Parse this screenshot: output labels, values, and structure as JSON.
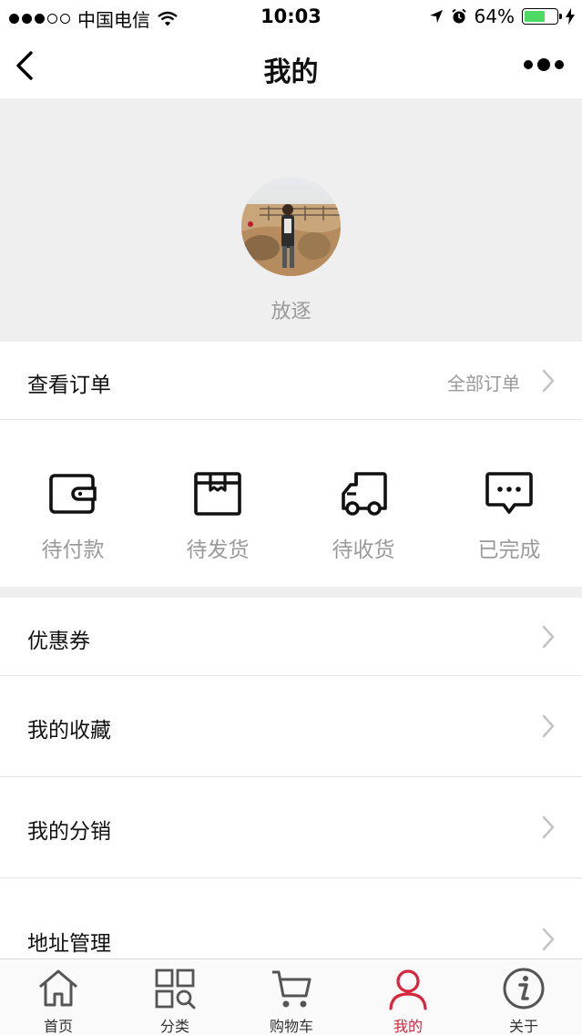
{
  "status_bar": {
    "carrier": "中国电信",
    "time": "10:03",
    "battery": "64%"
  },
  "nav": {
    "title": "我的"
  },
  "profile": {
    "username": "放逐"
  },
  "orders_row": {
    "label": "查看订单",
    "extra": "全部订单"
  },
  "order_status": [
    {
      "label": "待付款",
      "icon": "wallet-icon"
    },
    {
      "label": "待发货",
      "icon": "box-icon"
    },
    {
      "label": "待收货",
      "icon": "truck-icon"
    },
    {
      "label": "已完成",
      "icon": "chat-icon"
    }
  ],
  "menu": [
    {
      "label": "优惠券"
    },
    {
      "label": "我的收藏"
    },
    {
      "label": "我的分销"
    },
    {
      "label": "地址管理"
    }
  ],
  "tabs": [
    {
      "label": "首页",
      "icon": "home-icon"
    },
    {
      "label": "分类",
      "icon": "category-icon"
    },
    {
      "label": "购物车",
      "icon": "cart-icon"
    },
    {
      "label": "我的",
      "icon": "user-icon"
    },
    {
      "label": "关于",
      "icon": "info-icon"
    }
  ],
  "colors": {
    "accent": "#d7263d",
    "muted_text": "#9a9a9a",
    "header_bg": "#efefef",
    "battery": "#4cd964"
  }
}
